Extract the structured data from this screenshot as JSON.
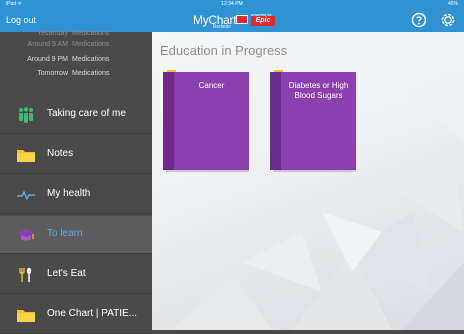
{
  "status_bar": {
    "left": "iPad ᯤ",
    "time": "12:34 PM",
    "battery": "46%"
  },
  "header": {
    "logout_label": "Log out",
    "logo_text": "MyChart",
    "logo_sub": "Bedside",
    "powered_by": "powered by",
    "powered_brand": "Epic",
    "help_icon": "question-circle-icon",
    "settings_icon": "gear-icon",
    "color": "#2f93d3"
  },
  "sidebar": {
    "schedule": [
      {
        "time": "Yesterday",
        "label": "Medications"
      },
      {
        "time": "Around 9 AM",
        "label": "Medications"
      },
      {
        "time": "Around 9 PM",
        "label": "Medications"
      },
      {
        "time": "Tomorrow",
        "label": "Medications"
      }
    ],
    "items": [
      {
        "label": "Taking care of me",
        "icon": "care-team-icon"
      },
      {
        "label": "Notes",
        "icon": "folder-icon"
      },
      {
        "label": "My health",
        "icon": "pulse-icon"
      },
      {
        "label": "To learn",
        "icon": "graduation-cap-icon",
        "active": true
      },
      {
        "label": "Let's Eat",
        "icon": "utensils-icon"
      },
      {
        "label": "One Chart | PATIE...",
        "icon": "folder-icon"
      }
    ],
    "active_color": "#5aa8e8"
  },
  "main": {
    "title": "Education in Progress",
    "books": [
      {
        "title": "Cancer"
      },
      {
        "title": "Diabetes or High Blood Sugars"
      }
    ],
    "book_color": "#8c3fae"
  }
}
